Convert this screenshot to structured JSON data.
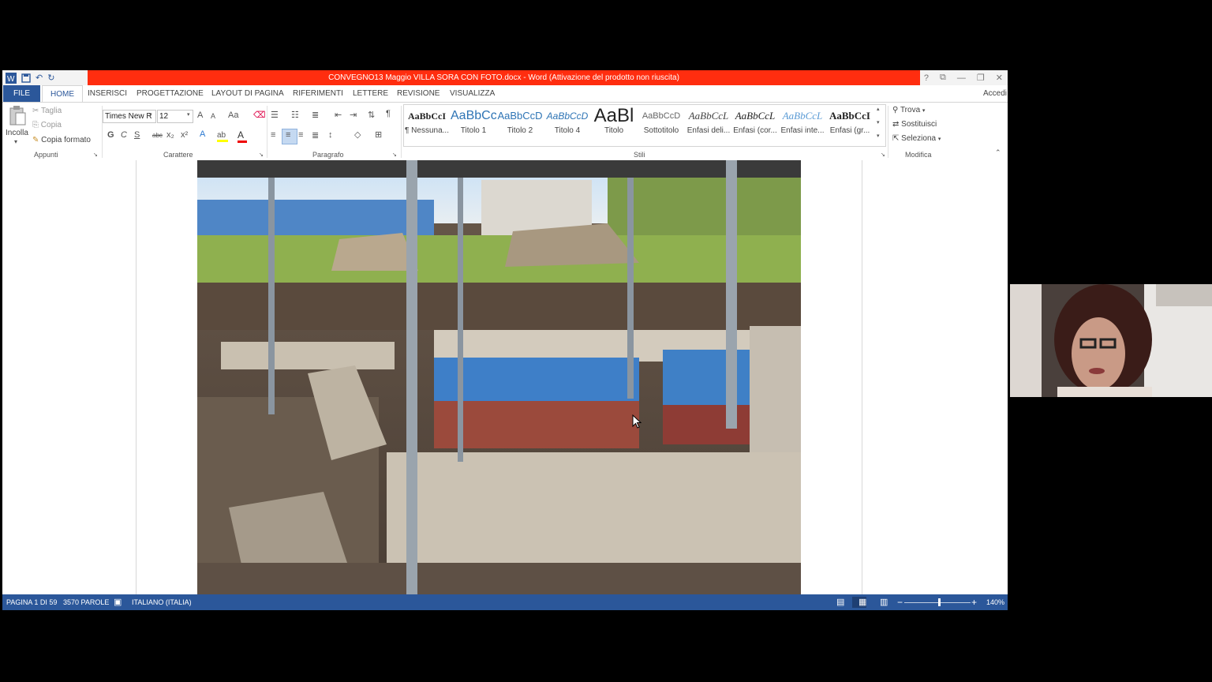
{
  "window": {
    "title": "CONVEGNO13 Maggio  VILLA SORA CON FOTO.docx -  Word (Attivazione del prodotto non riuscita)",
    "controls": [
      "?",
      "⧉",
      "—",
      "❐",
      "✕"
    ]
  },
  "tabs": [
    "FILE",
    "HOME",
    "INSERISCI",
    "PROGETTAZIONE",
    "LAYOUT DI PAGINA",
    "RIFERIMENTI",
    "LETTERE",
    "REVISIONE",
    "VISUALIZZA"
  ],
  "account": "Accedi",
  "clipboard": {
    "paste": "Incolla",
    "cut": "Taglia",
    "copy": "Copia",
    "format_painter": "Copia formato",
    "label": "Appunti"
  },
  "font": {
    "name": "Times New R",
    "size": "12",
    "label": "Carattere",
    "bold": "G",
    "italic": "C",
    "underline": "S",
    "strike": "abc",
    "sub": "x₂",
    "sup": "x²",
    "grow": "A",
    "shrink": "A",
    "case": "Aa"
  },
  "paragraph": {
    "label": "Paragrafo"
  },
  "styles": {
    "label": "Stili",
    "items": [
      {
        "sample": "AaBbCcI",
        "name": "¶ Nessuna..."
      },
      {
        "sample": "AaBbCc",
        "name": "Titolo 1"
      },
      {
        "sample": "AaBbCcD",
        "name": "Titolo 2"
      },
      {
        "sample": "AaBbCcD",
        "name": "Titolo 4"
      },
      {
        "sample": "AaBl",
        "name": "Titolo"
      },
      {
        "sample": "AaBbCcD",
        "name": "Sottotitolo"
      },
      {
        "sample": "AaBbCcL",
        "name": "Enfasi deli..."
      },
      {
        "sample": "AaBbCcL",
        "name": "Enfasi (cor..."
      },
      {
        "sample": "AaBbCcL",
        "name": "Enfasi inte..."
      },
      {
        "sample": "AaBbCcI",
        "name": "Enfasi (gr..."
      }
    ]
  },
  "editing": {
    "label": "Modifica",
    "find": "Trova",
    "replace": "Sostituisci",
    "select": "Seleziona"
  },
  "status": {
    "page": "PAGINA 1 DI 59",
    "words": "3570 PAROLE",
    "language": "ITALIANO (ITALIA)",
    "zoom": "140%"
  },
  "colors": {
    "accent": "#2b579a",
    "titlebar_alert": "#ff2d0f"
  }
}
